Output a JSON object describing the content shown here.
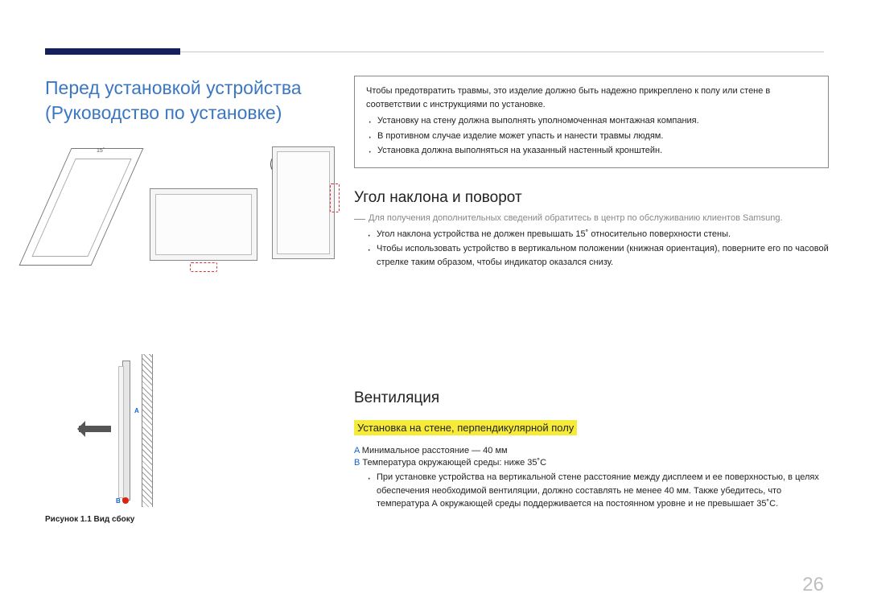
{
  "title_line1": "Перед установкой устройства",
  "title_line2": "(Руководство по установке)",
  "angle_label": "15˚",
  "warn": {
    "intro": "Чтобы предотвратить травмы, это изделие должно быть надежно прикреплено к полу или стене в соответствии с инструкциями по установке.",
    "b1": "Установку на стену должна выполнять уполномоченная монтажная компания.",
    "b2": "В противном случае изделие может упасть и нанести травмы людям.",
    "b3": "Установка должна выполняться на указанный настенный кронштейн."
  },
  "sec1": {
    "heading": "Угол наклона и поворот",
    "note": "Для получения дополнительных сведений обратитесь в центр по обслуживанию клиентов Samsung.",
    "b1": "Угол наклона устройства не должен превышать 15˚ относительно поверхности стены.",
    "b2": "Чтобы использовать устройство в вертикальном положении (книжная ориентация), поверните его по часовой стрелке таким образом, чтобы индикатор оказался снизу."
  },
  "sec2": {
    "heading": "Вентиляция",
    "sub": "Установка на стене, перпендикулярной полу",
    "a_label": "A",
    "a_text": " Минимальное расстояние — 40 мм",
    "b_label": "B",
    "b_text": " Температура окружающей среды: ниже 35˚C",
    "para": "При установке устройства на вертикальной стене расстояние между дисплеем и ее поверхностью, в целях обеспечения необходимой вентиляции, должно составлять не менее 40 мм. Также убедитесь, что температура А окружающей среды поддерживается на постоянном уровне и не превышает 35˚C."
  },
  "fig_caption": "Рисунок 1.1 Вид сбоку",
  "side_labels": {
    "A": "A",
    "B": "B"
  },
  "page_number": "26"
}
